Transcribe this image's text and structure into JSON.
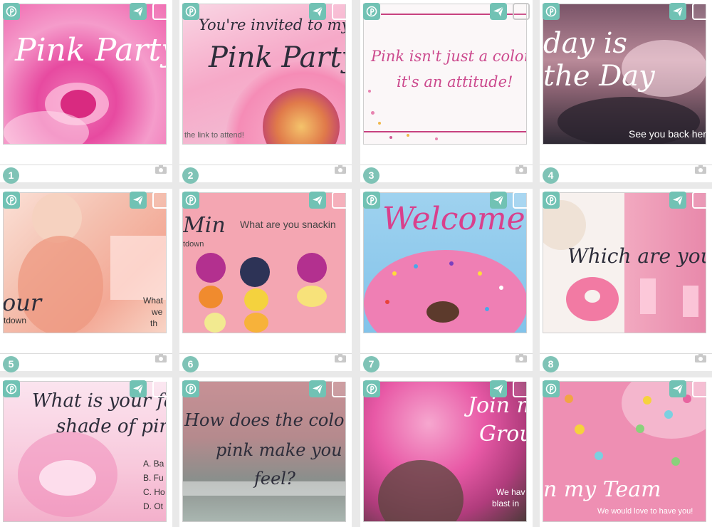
{
  "colors": {
    "accent": "#71c2b4",
    "number_badge": "#7fc3b6"
  },
  "icons": {
    "share": "pinterest-icon",
    "send": "send-icon",
    "select": "checkbox",
    "media": "camera-icon"
  },
  "cards": [
    {
      "number": "1",
      "texts": [
        "Pink Party"
      ]
    },
    {
      "number": "2",
      "texts": [
        "You're invited to my",
        "Pink Party",
        "the link to attend!"
      ]
    },
    {
      "number": "3",
      "texts": [
        "Pink isn't just a color-",
        "it's an attitude!"
      ]
    },
    {
      "number": "4",
      "texts": [
        "day is",
        "the Day",
        "See you back here"
      ]
    },
    {
      "number": "5",
      "texts": [
        "our",
        "tdown",
        "What",
        "we",
        "th"
      ]
    },
    {
      "number": "6",
      "texts": [
        "Min",
        "What are you snackin",
        "tdown"
      ]
    },
    {
      "number": "7",
      "texts": [
        "Welcome!"
      ]
    },
    {
      "number": "8",
      "texts": [
        "Which are you?"
      ]
    },
    {
      "number": "9",
      "texts": [
        "What is your fav",
        "shade of pink",
        "A. Ba",
        "B. Fu",
        "C. Ho",
        "D. Ot"
      ]
    },
    {
      "number": "10",
      "texts": [
        "How does the color",
        "pink make you",
        "feel?"
      ]
    },
    {
      "number": "11",
      "texts": [
        "Join m",
        "Grou",
        "We hav",
        "blast in"
      ]
    },
    {
      "number": "12",
      "texts": [
        "n my Team",
        "We would love to have you!"
      ]
    }
  ]
}
